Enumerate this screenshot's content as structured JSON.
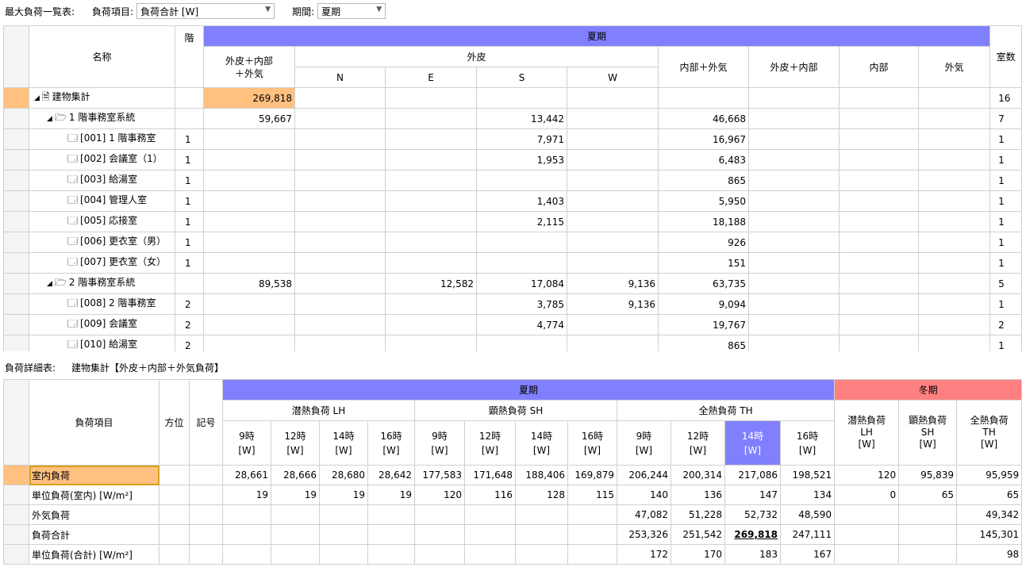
{
  "top_bar": {
    "title": "最大負荷一覧表:",
    "item_label": "負荷項目:",
    "item_value": "負荷合計 [W]",
    "period_label": "期間:",
    "period_value": "夏期"
  },
  "table1": {
    "headers": {
      "name": "名称",
      "floor": "階",
      "season": "夏期",
      "total": "外皮＋内部\n＋外気",
      "envelope": "外皮",
      "n": "N",
      "e": "E",
      "s": "S",
      "w": "W",
      "internal_outdoor": "内部＋外気",
      "env_internal": "外皮＋内部",
      "internal": "内部",
      "outdoor": "外気",
      "rooms": "室数"
    },
    "rows": [
      {
        "level": 0,
        "icon": "document-icon",
        "twist": "◢",
        "name": "建物集計",
        "floor": "",
        "total": "269,818",
        "n": "",
        "e": "",
        "s": "",
        "w": "",
        "io": "",
        "ei": "",
        "in": "",
        "out": "",
        "rooms": "16"
      },
      {
        "level": 1,
        "icon": "folder-icon",
        "twist": "◢",
        "name": "1 階事務室系統",
        "floor": "",
        "total": "59,667",
        "n": "",
        "e": "",
        "s": "13,442",
        "w": "",
        "io": "46,668",
        "ei": "",
        "in": "",
        "out": "",
        "rooms": "7"
      },
      {
        "level": 2,
        "icon": "room-icon",
        "twist": "",
        "name": "[001] 1 階事務室",
        "floor": "1",
        "total": "",
        "n": "",
        "e": "",
        "s": "7,971",
        "w": "",
        "io": "16,967",
        "ei": "",
        "in": "",
        "out": "",
        "rooms": "1"
      },
      {
        "level": 2,
        "icon": "room-icon",
        "twist": "",
        "name": "[002] 会議室（1）",
        "floor": "1",
        "total": "",
        "n": "",
        "e": "",
        "s": "1,953",
        "w": "",
        "io": "6,483",
        "ei": "",
        "in": "",
        "out": "",
        "rooms": "1"
      },
      {
        "level": 2,
        "icon": "room-icon",
        "twist": "",
        "name": "[003] 給湯室",
        "floor": "1",
        "total": "",
        "n": "",
        "e": "",
        "s": "",
        "w": "",
        "io": "865",
        "ei": "",
        "in": "",
        "out": "",
        "rooms": "1"
      },
      {
        "level": 2,
        "icon": "room-icon",
        "twist": "",
        "name": "[004] 管理人室",
        "floor": "1",
        "total": "",
        "n": "",
        "e": "",
        "s": "1,403",
        "w": "",
        "io": "5,950",
        "ei": "",
        "in": "",
        "out": "",
        "rooms": "1"
      },
      {
        "level": 2,
        "icon": "room-icon",
        "twist": "",
        "name": "[005] 応接室",
        "floor": "1",
        "total": "",
        "n": "",
        "e": "",
        "s": "2,115",
        "w": "",
        "io": "18,188",
        "ei": "",
        "in": "",
        "out": "",
        "rooms": "1"
      },
      {
        "level": 2,
        "icon": "room-icon",
        "twist": "",
        "name": "[006] 更衣室（男）",
        "floor": "1",
        "total": "",
        "n": "",
        "e": "",
        "s": "",
        "w": "",
        "io": "926",
        "ei": "",
        "in": "",
        "out": "",
        "rooms": "1"
      },
      {
        "level": 2,
        "icon": "room-icon",
        "twist": "",
        "name": "[007] 更衣室（女）",
        "floor": "1",
        "total": "",
        "n": "",
        "e": "",
        "s": "",
        "w": "",
        "io": "151",
        "ei": "",
        "in": "",
        "out": "",
        "rooms": "1"
      },
      {
        "level": 1,
        "icon": "folder-icon",
        "twist": "◢",
        "name": "2 階事務室系統",
        "floor": "",
        "total": "89,538",
        "n": "",
        "e": "12,582",
        "s": "17,084",
        "w": "9,136",
        "io": "63,735",
        "ei": "",
        "in": "",
        "out": "",
        "rooms": "5"
      },
      {
        "level": 2,
        "icon": "room-icon",
        "twist": "",
        "name": "[008] 2 階事務室",
        "floor": "2",
        "total": "",
        "n": "",
        "e": "",
        "s": "3,785",
        "w": "9,136",
        "io": "9,094",
        "ei": "",
        "in": "",
        "out": "",
        "rooms": "1"
      },
      {
        "level": 2,
        "icon": "room-icon",
        "twist": "",
        "name": "[009] 会議室",
        "floor": "2",
        "total": "",
        "n": "",
        "e": "",
        "s": "4,774",
        "w": "",
        "io": "19,767",
        "ei": "",
        "in": "",
        "out": "",
        "rooms": "2"
      },
      {
        "level": 2,
        "icon": "room-icon",
        "twist": "",
        "name": "[010] 給湯室",
        "floor": "2",
        "total": "",
        "n": "",
        "e": "",
        "s": "",
        "w": "",
        "io": "865",
        "ei": "",
        "in": "",
        "out": "",
        "rooms": "1"
      }
    ]
  },
  "detail_bar": {
    "title": "負荷詳細表:",
    "subject": "建物集計【外皮＋内部＋外気負荷】"
  },
  "table2": {
    "headers": {
      "item": "負荷項目",
      "direction": "方位",
      "symbol": "記号",
      "summer": "夏期",
      "winter": "冬期",
      "latent": "潜熱負荷 LH",
      "sensible": "顕熱負荷 SH",
      "total_heat": "全熱負荷 TH",
      "hours": [
        "9時\n[W]",
        "12時\n[W]",
        "14時\n[W]",
        "16時\n[W]"
      ],
      "w_lh": "潜熱負荷\nLH\n[W]",
      "w_sh": "顕熱負荷\nSH\n[W]",
      "w_th": "全熱負荷\nTH\n[W]"
    },
    "rows": [
      {
        "item": "室内負荷",
        "vals": [
          "28,661",
          "28,666",
          "28,680",
          "28,642",
          "177,583",
          "171,648",
          "188,406",
          "169,879",
          "206,244",
          "200,314",
          "217,086",
          "198,521",
          "120",
          "95,839",
          "95,959"
        ]
      },
      {
        "item": "単位負荷(室内) [W/m²]",
        "vals": [
          "19",
          "19",
          "19",
          "19",
          "120",
          "116",
          "128",
          "115",
          "140",
          "136",
          "147",
          "134",
          "0",
          "65",
          "65"
        ]
      },
      {
        "item": "外気負荷",
        "vals": [
          "",
          "",
          "",
          "",
          "",
          "",
          "",
          "",
          "47,082",
          "51,228",
          "52,732",
          "48,590",
          "",
          "",
          "49,342"
        ]
      },
      {
        "item": "負荷合計",
        "vals": [
          "",
          "",
          "",
          "",
          "",
          "",
          "",
          "",
          "253,326",
          "251,542",
          "269,818",
          "247,111",
          "",
          "",
          "145,301"
        ]
      },
      {
        "item": "単位負荷(合計) [W/m²]",
        "vals": [
          "",
          "",
          "",
          "",
          "",
          "",
          "",
          "",
          "172",
          "170",
          "183",
          "167",
          "",
          "",
          "98"
        ]
      }
    ]
  },
  "colors": {
    "summer": "#8080ff",
    "winter": "#ff8080",
    "highlight": "#ffc080"
  }
}
